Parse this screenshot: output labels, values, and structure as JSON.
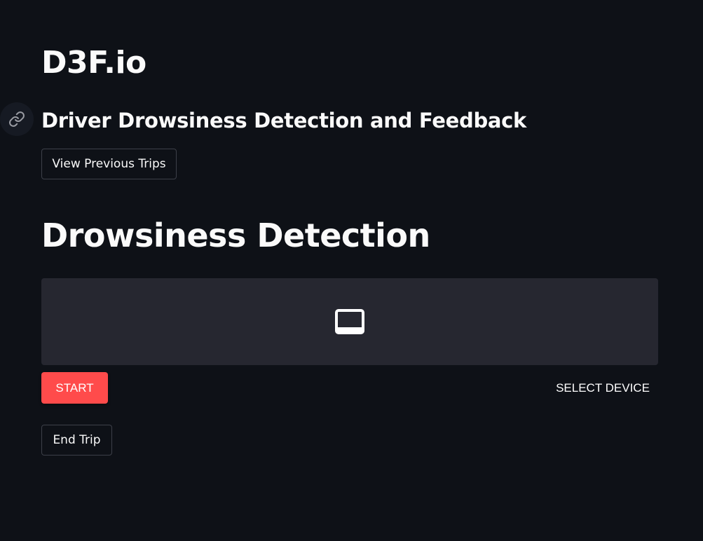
{
  "header": {
    "app_title": "D3F.io",
    "subtitle": "Driver Drowsiness Detection and Feedback",
    "link_icon": "link-icon"
  },
  "actions": {
    "view_previous_trips_label": "View Previous Trips"
  },
  "detection": {
    "title": "Drowsiness Detection",
    "video_icon": "video-placeholder-icon",
    "start_label": "START",
    "select_device_label": "SELECT DEVICE",
    "end_trip_label": "End Trip"
  },
  "colors": {
    "background": "#0e1117",
    "panel": "#262730",
    "accent": "#ff4b4b",
    "text": "#fafafa"
  }
}
